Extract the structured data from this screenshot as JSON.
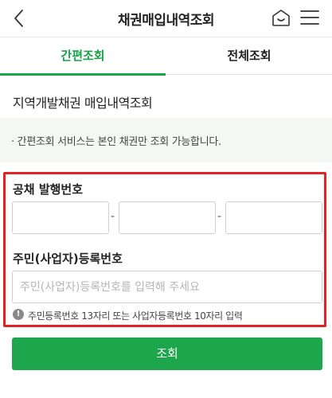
{
  "header": {
    "title": "채권매입내역조회"
  },
  "tabs": [
    {
      "label": "간편조회"
    },
    {
      "label": "전체조회"
    }
  ],
  "section": {
    "title": "지역개발채권 매입내역조회"
  },
  "notice": {
    "text": "· 간편조회 서비스는 본인 채권만 조회 가능합니다."
  },
  "form": {
    "bond_label": "공채 발행번호",
    "separator": "-",
    "reg_label": "주민(사업자)등록번호",
    "reg_placeholder": "주민(사업자)등록번호를 입력해 주세요",
    "hint_icon": "!",
    "hint": "주민등록번호 13자리 또는 사업자등록번호 10자리 입력"
  },
  "submit": {
    "label": "조회"
  },
  "colors": {
    "accent": "#1aa34a",
    "button": "#1da64b",
    "highlight": "#e42226"
  }
}
